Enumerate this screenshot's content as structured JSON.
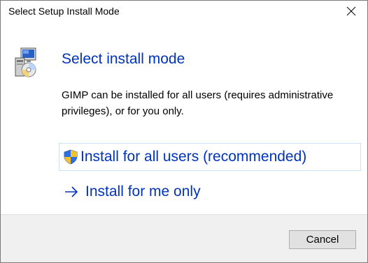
{
  "window": {
    "title": "Select Setup Install Mode"
  },
  "content": {
    "heading": "Select install mode",
    "description": "GIMP can be installed for all users (requires administrative privileges), or for you only."
  },
  "options": [
    {
      "label": "Install for all users (recommended)",
      "icon": "uac-shield-icon",
      "highlighted": true
    },
    {
      "label": "Install for me only",
      "icon": "arrow-right-icon",
      "highlighted": false
    }
  ],
  "footer": {
    "cancel_label": "Cancel"
  },
  "colors": {
    "link_blue": "#0033bc",
    "footer_bg": "#f0f0f0",
    "hover_border": "#cce4f7"
  }
}
